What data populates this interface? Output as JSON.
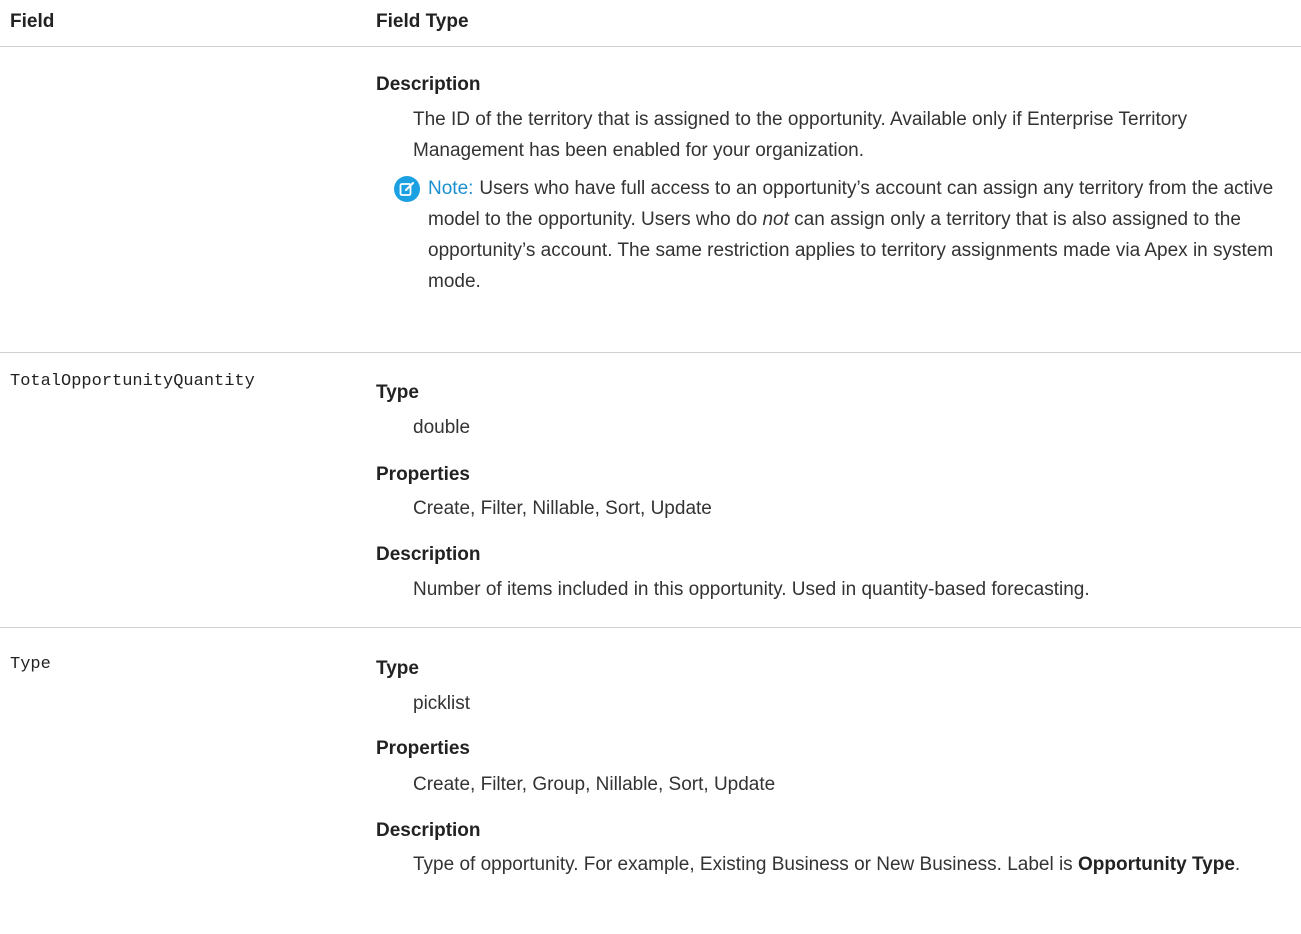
{
  "header": {
    "field": "Field",
    "field_type": "Field Type"
  },
  "territory_row": {
    "description_label": "Description",
    "description": "The ID of the territory that is assigned to the opportunity. Available only if Enterprise Territory Management has been enabled for your organization.",
    "note": {
      "label": "Note:",
      "text_1": "Users who have full access to an opportunity’s account can assign any territory from the active model to the opportunity. Users who do ",
      "text_italic": "not",
      "text_2": " can assign only a territory that is also assigned to the opportunity’s account. The same restriction applies to territory assignments made via Apex in system mode."
    }
  },
  "quantity_row": {
    "field_name": "TotalOpportunityQuantity",
    "type_label": "Type",
    "type_value": "double",
    "properties_label": "Properties",
    "properties_value": "Create, Filter, Nillable, Sort, Update",
    "description_label": "Description",
    "description": "Number of items included in this opportunity. Used in quantity-based forecasting."
  },
  "type_row": {
    "field_name": "Type",
    "type_label": "Type",
    "type_value": "picklist",
    "properties_label": "Properties",
    "properties_value": "Create, Filter, Group, Nillable, Sort, Update",
    "description_label": "Description",
    "description_1": "Type of opportunity. For example, Existing Business or New Business. Label is ",
    "description_bold": "Opportunity Type",
    "description_2": "."
  },
  "icons": {
    "note": "note-edit-icon"
  },
  "colors": {
    "note_accent": "#1ba0e1",
    "divider": "#cfcfcf"
  }
}
